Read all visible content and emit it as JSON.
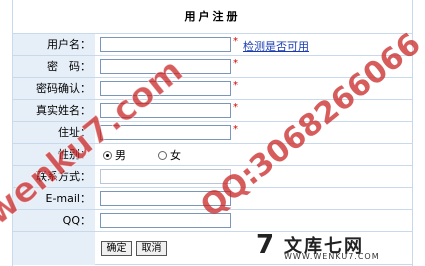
{
  "form": {
    "title": "用户注册",
    "check_link": "检测是否可用",
    "fields": [
      {
        "label": "用户名：",
        "value": "",
        "required": true
      },
      {
        "label": "密　码：",
        "value": "",
        "required": true
      },
      {
        "label": "密码确认：",
        "value": "",
        "required": true
      },
      {
        "label": "真实姓名：",
        "value": "",
        "required": true
      },
      {
        "label": "住址：",
        "value": "",
        "required": true
      }
    ],
    "gender": {
      "label": "性别：",
      "male": "男",
      "female": "女",
      "selected": "男"
    },
    "contact": {
      "label": "联系方式："
    },
    "email": {
      "label": "E-mail：",
      "value": ""
    },
    "qq": {
      "label": "QQ：",
      "value": ""
    },
    "required_mark": "*",
    "buttons": {
      "confirm": "确定",
      "cancel": "取消"
    }
  },
  "watermarks": {
    "left": "wenku7.com",
    "right": "QQ:3068266066"
  },
  "logo": {
    "mark": "7",
    "name": "文库七网",
    "url": "WWW.WENKU7.COM"
  },
  "colors": {
    "label_bg": "#e6eef8",
    "border": "#c9d9ec",
    "required": "#d40000",
    "link": "#1a3cb0"
  }
}
